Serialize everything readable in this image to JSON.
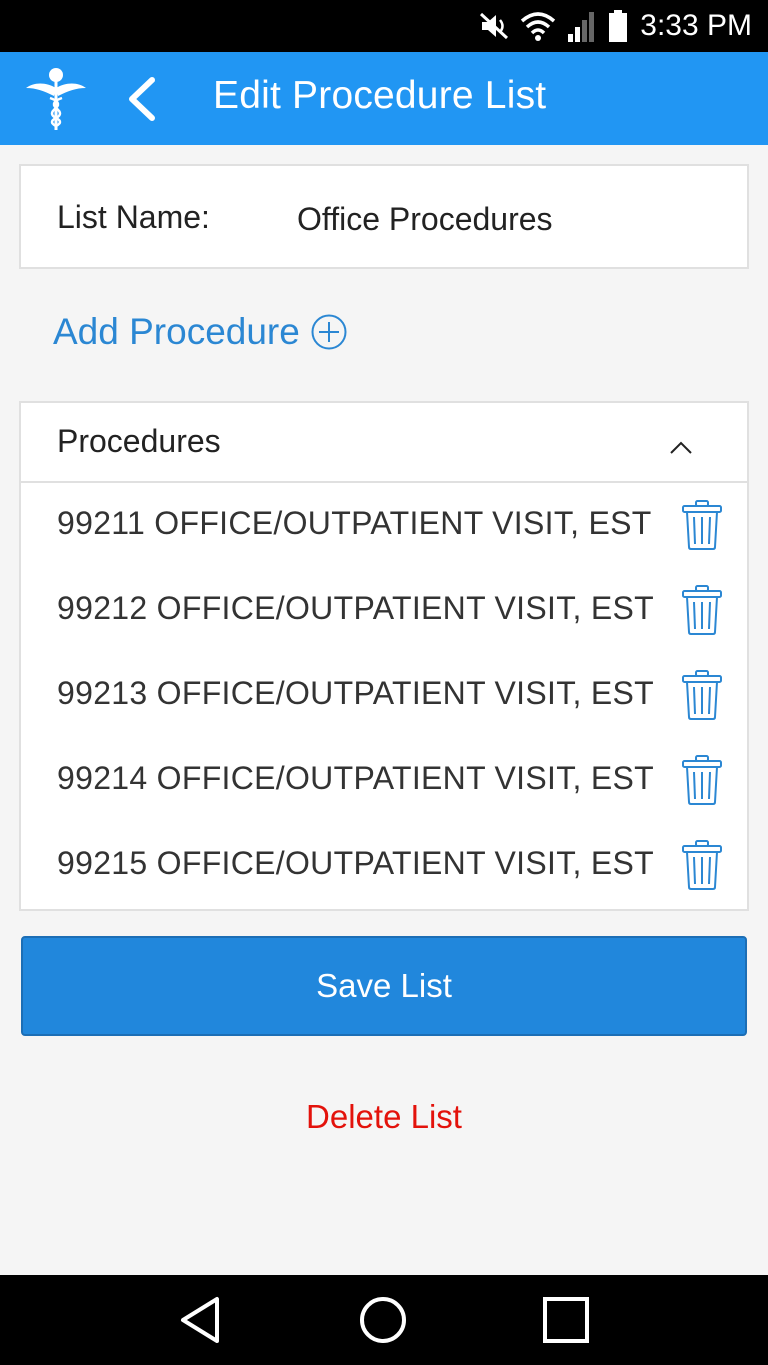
{
  "status_bar": {
    "time": "3:33 PM",
    "icons": [
      "mute-icon",
      "wifi-icon",
      "signal-icon",
      "battery-icon"
    ]
  },
  "app_bar": {
    "title": "Edit Procedure List",
    "logo_icon": "caduceus-icon",
    "back_icon": "chevron-left-icon",
    "color": "#2196f3"
  },
  "list_name": {
    "label": "List Name:",
    "value": "Office Procedures"
  },
  "add_procedure": {
    "label": "Add Procedure",
    "icon": "plus-circle-icon",
    "color": "#2b87d3"
  },
  "procedures": {
    "header": "Procedures",
    "collapse_icon": "chevron-up-icon",
    "items": [
      {
        "label": "99211 OFFICE/OUTPATIENT VISIT, EST"
      },
      {
        "label": "99212 OFFICE/OUTPATIENT VISIT, EST"
      },
      {
        "label": "99213 OFFICE/OUTPATIENT VISIT, EST"
      },
      {
        "label": "99214 OFFICE/OUTPATIENT VISIT, EST"
      },
      {
        "label": "99215 OFFICE/OUTPATIENT VISIT, EST"
      }
    ],
    "delete_icon": "trash-icon"
  },
  "actions": {
    "save_label": "Save List",
    "delete_label": "Delete List",
    "save_color": "#2187dc",
    "delete_color": "#e3120b"
  },
  "nav_bar": {
    "icons": [
      "back-triangle-icon",
      "home-circle-icon",
      "recents-square-icon"
    ]
  }
}
